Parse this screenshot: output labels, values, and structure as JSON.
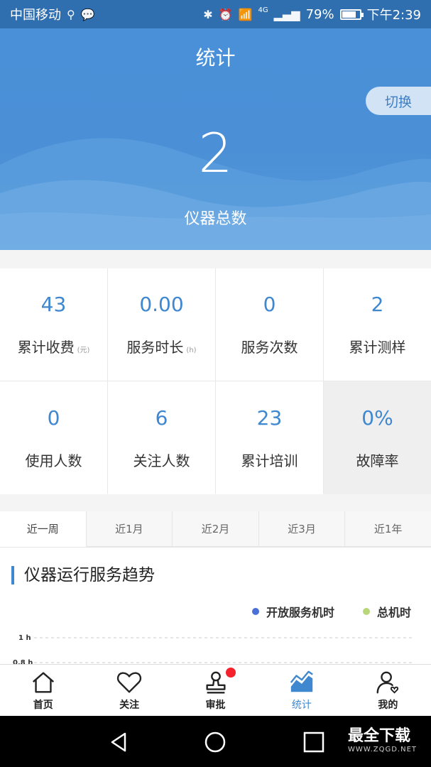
{
  "status_bar": {
    "carrier": "中国移动",
    "network": "4G",
    "battery": "79%",
    "battery_level": 0.79,
    "time": "下午2:39"
  },
  "header": {
    "title": "统计",
    "switch_label": "切换",
    "total_value": "2",
    "total_label": "仪器总数"
  },
  "stats": [
    {
      "value": "43",
      "label": "累计收费",
      "unit": "(元)"
    },
    {
      "value": "0.00",
      "label": "服务时长",
      "unit": "(h)"
    },
    {
      "value": "0",
      "label": "服务次数",
      "unit": ""
    },
    {
      "value": "2",
      "label": "累计测样",
      "unit": ""
    },
    {
      "value": "0",
      "label": "使用人数",
      "unit": ""
    },
    {
      "value": "6",
      "label": "关注人数",
      "unit": ""
    },
    {
      "value": "23",
      "label": "累计培训",
      "unit": ""
    },
    {
      "value": "0%",
      "label": "故障率",
      "unit": ""
    }
  ],
  "range_tabs": [
    "近一周",
    "近1月",
    "近2月",
    "近3月",
    "近1年"
  ],
  "active_tab": 0,
  "chart_section": {
    "title": "仪器运行服务趋势"
  },
  "chart_data": {
    "type": "line",
    "series": [
      {
        "name": "开放服务机时",
        "color": "#4a6fd6",
        "values": []
      },
      {
        "name": "总机时",
        "color": "#b9d77a",
        "values": []
      }
    ],
    "y_ticks": [
      "1 h",
      "0.8 h"
    ],
    "legend_position": "top-right"
  },
  "bottom_nav": [
    {
      "label": "首页",
      "icon": "home-icon"
    },
    {
      "label": "关注",
      "icon": "heart-icon"
    },
    {
      "label": "审批",
      "icon": "stamp-icon",
      "badge": true
    },
    {
      "label": "统计",
      "icon": "chart-icon",
      "active": true
    },
    {
      "label": "我的",
      "icon": "user-icon"
    }
  ],
  "watermark": {
    "text": "最全下载",
    "url": "WWW.ZQGD.NET"
  },
  "colors": {
    "primary": "#3f87cf",
    "status_bar": "#2f6fb0",
    "badge": "#f5222d"
  }
}
